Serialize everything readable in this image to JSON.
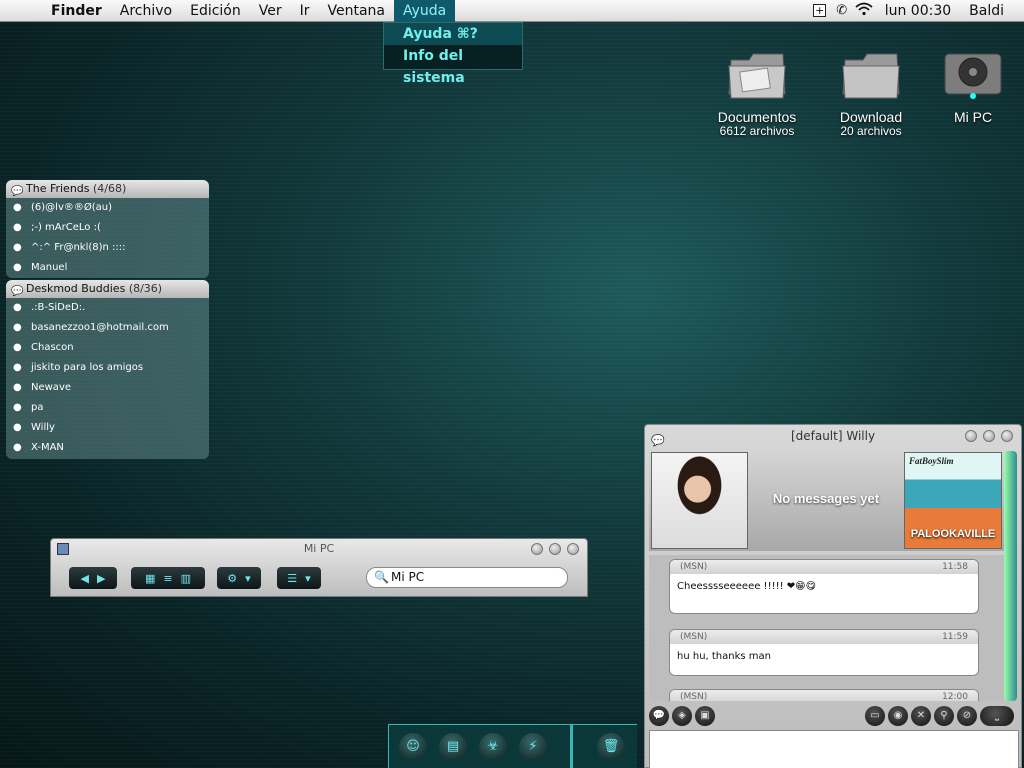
{
  "menubar": {
    "apple": "",
    "items": [
      "Finder",
      "Archivo",
      "Edición",
      "Ver",
      "Ir",
      "Ventana",
      "Ayuda"
    ],
    "clock": "lun 00:30",
    "user": "Baldi"
  },
  "help_menu": {
    "items": [
      "Ayuda ⌘?",
      "Info del sistema"
    ]
  },
  "desktop": {
    "icons": [
      {
        "label": "Documentos",
        "sub": "6612 archivos"
      },
      {
        "label": "Download",
        "sub": "20 archivos"
      },
      {
        "label": "Mi PC",
        "sub": ""
      }
    ]
  },
  "buddies": {
    "groups": [
      {
        "name": "The Friends",
        "count": "(4/68)",
        "members": [
          "(6)@lv®®Ø(au)",
          ";-) mArCeLo :(",
          "^:^ Fr@nkl(8)n ::::",
          "Manuel"
        ]
      },
      {
        "name": "Deskmod Buddies",
        "count": "(8/36)",
        "members": [
          ".:B-SiDeD:.",
          "basanezzoo1@hotmail.com",
          "Chascon",
          "jiskito para los amigos",
          "Newave",
          "pa",
          "Willy",
          "X-MAN"
        ]
      }
    ]
  },
  "finder": {
    "title": "Mi PC",
    "search_value": "Mi PC"
  },
  "chat": {
    "title": "[default] Willy",
    "no_messages": "No messages yet",
    "album_top": "FatBoySlim",
    "album_name": "PALOOKAVILLE",
    "messages": [
      {
        "service": "(MSN)",
        "time": "11:58",
        "text": "Cheesssseeeeee !!!!! ❤😁😋"
      },
      {
        "service": "(MSN)",
        "time": "11:59",
        "text": "hu hu, thanks man"
      },
      {
        "service": "(MSN)",
        "time": "12:00",
        "text": ""
      }
    ]
  }
}
